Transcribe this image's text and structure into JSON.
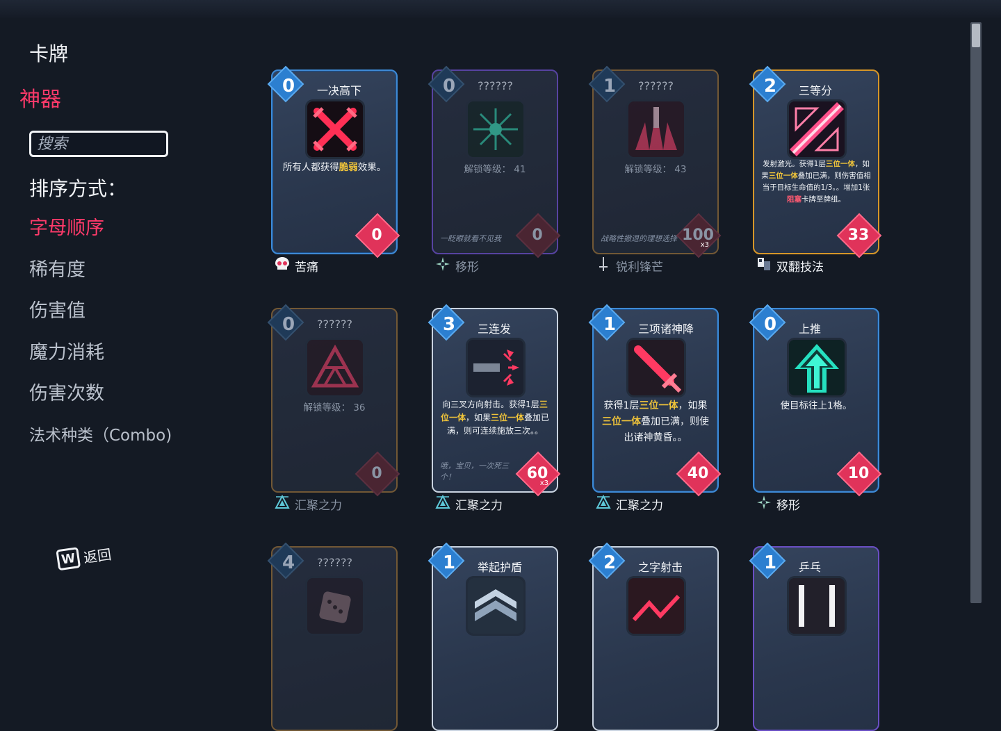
{
  "sidebar": {
    "title": "卡牌",
    "active_section": "神器",
    "search_placeholder": "搜索",
    "sort_label": "排序方式：",
    "sort_options": [
      "字母顺序",
      "稀有度",
      "伤害值",
      "魔力消耗",
      "伤害次数",
      "法术种类（Combo)"
    ],
    "active_sort": "字母顺序"
  },
  "back": {
    "key": "W",
    "label": "返回"
  },
  "colors": {
    "accent": "#ff3a6a",
    "highlight": "#f0c43a",
    "badge": "#e0335a"
  },
  "cards": [
    {
      "cost": "0",
      "name": "一决高下",
      "locked": false,
      "rarity": "blue",
      "icon": "crossed-swords-icon",
      "desc_parts": [
        {
          "t": "所有人都获得"
        },
        {
          "t": "脆弱",
          "hl": true
        },
        {
          "t": "效果。"
        }
      ],
      "damage": "0",
      "mult": "",
      "tag": "苦痛",
      "tag_icon": "skull-icon"
    },
    {
      "cost": "0",
      "name": "??????",
      "locked": true,
      "rarity": "purple",
      "icon": "starburst-icon",
      "lock_label": "解锁等级： 41",
      "flavor": "一眨眼就看不见我",
      "damage": "0",
      "mult": "",
      "tag": "移形",
      "tag_icon": "shuriken-icon"
    },
    {
      "cost": "1",
      "name": "??????",
      "locked": true,
      "rarity": "bronze",
      "icon": "spike-burst-icon",
      "lock_label": "解锁等级： 43",
      "flavor": "战略性撤退的理想选择",
      "damage": "100",
      "mult": "x3",
      "tag": "锐利锋芒",
      "tag_icon": "dagger-icon"
    },
    {
      "cost": "2",
      "name": "三等分",
      "locked": false,
      "rarity": "gold",
      "icon": "laser-triangles-icon",
      "desc_parts": [
        {
          "t": "发射激光。获得1层"
        },
        {
          "t": "三位一体",
          "hl": true
        },
        {
          "t": "，如果"
        },
        {
          "t": "三位一体",
          "hl": true
        },
        {
          "t": "叠加已满，则伤害值相当于目标生命值的1/3。。增加1张"
        },
        {
          "t": "阻塞",
          "hl2": true
        },
        {
          "t": "卡牌至牌组。"
        }
      ],
      "desc_size": "small",
      "damage": "33",
      "mult": "",
      "tag": "双翻技法",
      "tag_icon": "cards-icon"
    },
    {
      "cost": "0",
      "name": "??????",
      "locked": true,
      "rarity": "bronze",
      "icon": "triforce-icon",
      "lock_label": "解锁等级： 36",
      "flavor": "",
      "damage": "0",
      "mult": "",
      "tag": "汇聚之力",
      "tag_icon": "triangles-icon"
    },
    {
      "cost": "3",
      "name": "三连发",
      "locked": false,
      "rarity": "white",
      "icon": "triple-arrows-icon",
      "desc_parts": [
        {
          "t": "向三叉方向射击。获得1层"
        },
        {
          "t": "三位一体",
          "hl": true
        },
        {
          "t": "，如果"
        },
        {
          "t": "三位一体",
          "hl": true
        },
        {
          "t": "叠加已满，则可连续施放三次。。"
        }
      ],
      "desc_size": "mid",
      "flavor": "哦，宝贝，一次死三个！",
      "damage": "60",
      "mult": "x3",
      "tag": "汇聚之力",
      "tag_icon": "triangles-icon"
    },
    {
      "cost": "1",
      "name": "三项诸神降",
      "locked": false,
      "rarity": "blue",
      "icon": "diving-sword-icon",
      "desc_parts": [
        {
          "t": "获得1层"
        },
        {
          "t": "三位一体",
          "hl": true
        },
        {
          "t": "，如果"
        },
        {
          "t": "三位一体",
          "hl": true
        },
        {
          "t": "叠加已满，则使出诸神黄昏。。"
        }
      ],
      "desc_size": "big",
      "damage": "40",
      "mult": "",
      "tag": "汇聚之力",
      "tag_icon": "triangles-icon"
    },
    {
      "cost": "0",
      "name": "上推",
      "locked": false,
      "rarity": "blue",
      "icon": "up-arrow-icon",
      "desc_parts": [
        {
          "t": "使目标往上1格。"
        }
      ],
      "damage": "10",
      "mult": "",
      "tag": "移形",
      "tag_icon": "shuriken-icon"
    },
    {
      "cost": "4",
      "name": "??????",
      "locked": true,
      "rarity": "bronze",
      "icon": "dice-icon",
      "lock_label": "",
      "flavor": "",
      "damage": "",
      "mult": "",
      "tag": "",
      "tag_icon": ""
    },
    {
      "cost": "1",
      "name": "举起护盾",
      "locked": false,
      "rarity": "white",
      "icon": "chevron-shield-icon",
      "desc_parts": [],
      "damage": "",
      "mult": "",
      "tag": "",
      "tag_icon": ""
    },
    {
      "cost": "2",
      "name": "之字射击",
      "locked": false,
      "rarity": "white",
      "icon": "zigzag-icon",
      "desc_parts": [],
      "damage": "",
      "mult": "",
      "tag": "",
      "tag_icon": ""
    },
    {
      "cost": "1",
      "name": "乒乓",
      "locked": false,
      "rarity": "purple",
      "icon": "bars-icon",
      "desc_parts": [],
      "damage": "",
      "mult": "",
      "tag": "",
      "tag_icon": ""
    }
  ]
}
